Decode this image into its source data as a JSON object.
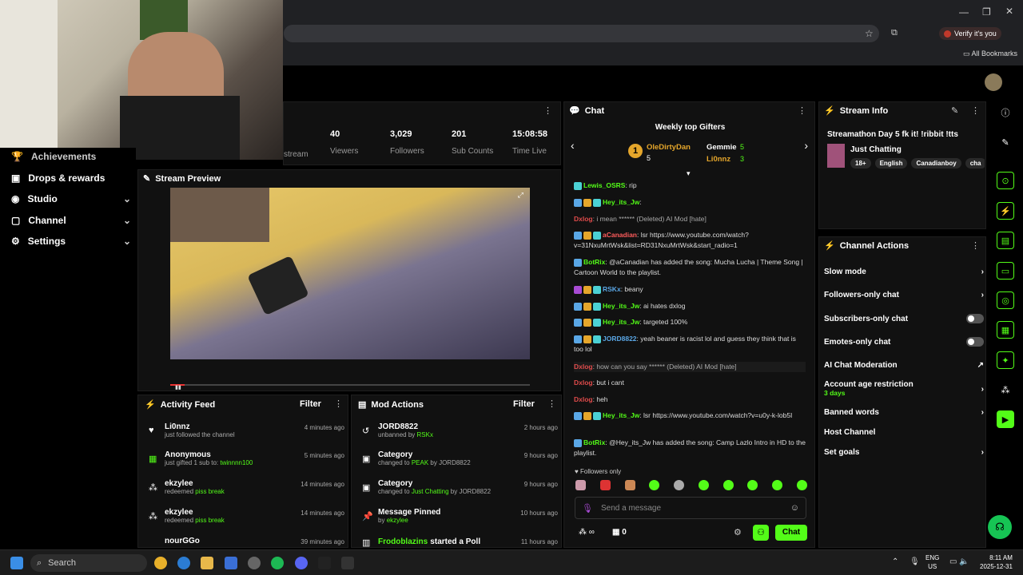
{
  "browser": {
    "verify": "Verify it's you",
    "bookmarks": "All Bookmarks"
  },
  "nav": [
    {
      "label": "Achievements"
    },
    {
      "label": "Drops & rewards"
    },
    {
      "label": "Studio"
    },
    {
      "label": "Channel"
    },
    {
      "label": "Settings"
    }
  ],
  "stats": [
    {
      "value": "40",
      "label": "Viewers"
    },
    {
      "value": "3,029",
      "label": "Followers"
    },
    {
      "value": "201",
      "label": "Sub Counts"
    },
    {
      "value": "15:08:58",
      "label": "Time Live"
    }
  ],
  "stats_partial": {
    "label": "stream"
  },
  "preview": {
    "title": "Stream Preview"
  },
  "activity": {
    "title": "Activity Feed",
    "filter": "Filter",
    "items": [
      {
        "name": "Li0nnz",
        "sub": "just followed the channel",
        "time": "4 minutes ago"
      },
      {
        "name": "Anonymous",
        "sub": "just gifted 1 sub to:",
        "sub2": "twinnnn100",
        "time": "5 minutes ago"
      },
      {
        "name": "ekzylee",
        "sub": "redeemed",
        "sub2": "piss break",
        "time": "14 minutes ago"
      },
      {
        "name": "ekzylee",
        "sub": "redeemed",
        "sub2": "piss break",
        "time": "14 minutes ago"
      },
      {
        "name": "nourGGo",
        "time": "39 minutes ago"
      }
    ]
  },
  "mod": {
    "title": "Mod Actions",
    "filter": "Filter",
    "items": [
      {
        "name": "JORD8822",
        "sub": "unbanned by",
        "sub2": "RSKx",
        "time": "2 hours ago"
      },
      {
        "name": "Category",
        "sub": "changed to",
        "sub2": "PEAK",
        "sub3": "by JORD8822",
        "time": "9 hours ago"
      },
      {
        "name": "Category",
        "sub": "changed to",
        "sub2": "Just Chatting",
        "sub3": "by JORD8822",
        "time": "9 hours ago"
      },
      {
        "name": "Message Pinned",
        "sub": "by",
        "sub2": "ekzylee",
        "time": "10 hours ago"
      },
      {
        "name": "Frodoblazins",
        "sub": "started a Poll",
        "time": "11 hours ago"
      }
    ]
  },
  "chat": {
    "title": "Chat",
    "gifters_title": "Weekly top Gifters",
    "gifters": [
      {
        "name": "OleDirtyDan",
        "count": "5"
      },
      {
        "name": "Gemmie",
        "count": "5"
      },
      {
        "name": "Li0nnz",
        "count": "3"
      }
    ],
    "lines": [
      {
        "user": "Lewis_OSRS",
        "msg": ": rip",
        "color": "#53fc18"
      },
      {
        "user": "Hey_its_Jw",
        "msg": ":",
        "color": "#53fc18"
      },
      {
        "user": "Dxlog",
        "msg": ": i mean ****** (Deleted) AI Mod [hate]",
        "color": "#e04b4b"
      },
      {
        "user": "aCanadian",
        "msg": ": lsr https://www.youtube.com/watch?v=31NxuMrtWsk&list=RD31NxuMrtWsk&start_radio=1",
        "color": "#ff5c5c"
      },
      {
        "user": "BotRix",
        "msg": ": @aCanadian has added the song: Mucha Lucha | Theme Song | Cartoon World to the playlist.",
        "color": "#53fc18"
      },
      {
        "user": "RSKx",
        "msg": ": beany",
        "color": "#5aa7e6"
      },
      {
        "user": "Hey_its_Jw",
        "msg": ": ai hates dxlog",
        "color": "#53fc18"
      },
      {
        "user": "Hey_its_Jw",
        "msg": ": targeted 100%",
        "color": "#53fc18"
      },
      {
        "user": "JORD8822",
        "msg": ": yeah beaner is racist lol and guess they think that is too lol",
        "color": "#5aa7e6"
      },
      {
        "user": "Dxlog",
        "msg": ": how can you say ****** (Deleted) AI Mod [hate]",
        "color": "#e04b4b"
      },
      {
        "user": "Dxlog",
        "msg": ": but i cant",
        "color": "#e04b4b"
      },
      {
        "user": "Dxlog",
        "msg": ": heh",
        "color": "#e04b4b"
      },
      {
        "user": "Hey_its_Jw",
        "msg": ": lsr https://www.youtube.com/watch?v=u0y-k-lob5I",
        "color": "#53fc18"
      },
      {
        "user": "BotRix",
        "msg": ": @Hey_its_Jw has added the song: Camp Lazlo Intro in HD to the playlist.",
        "color": "#53fc18"
      }
    ],
    "followers_only": "Followers only",
    "placeholder": "Send a message",
    "send": "Chat",
    "count": "0"
  },
  "info": {
    "title": "Stream Info",
    "stream_title": "Streamathon Day 5 fk it! !ribbit !tts",
    "category": "Just Chatting",
    "tags": [
      "18+",
      "English",
      "Canadianboy",
      "cha"
    ]
  },
  "actions": {
    "title": "Channel Actions",
    "items": [
      {
        "label": "Slow mode",
        "kind": "chev"
      },
      {
        "label": "Followers-only chat",
        "kind": "chev"
      },
      {
        "label": "Subscribers-only chat",
        "kind": "toggle"
      },
      {
        "label": "Emotes-only chat",
        "kind": "toggle"
      },
      {
        "label": "AI Chat Moderation",
        "kind": "ext"
      },
      {
        "label": "Account age restriction",
        "sub": "3 days",
        "kind": "chev"
      },
      {
        "label": "Banned words",
        "kind": "chev"
      },
      {
        "label": "Host Channel",
        "kind": "none"
      },
      {
        "label": "Set goals",
        "kind": "chev"
      }
    ]
  },
  "taskbar": {
    "search": "Search",
    "lang": "ENG",
    "region": "US",
    "time": "8:11 AM",
    "date": "2025-12-31"
  },
  "colors": {
    "accent": "#53fc18",
    "panel": "#111111"
  }
}
